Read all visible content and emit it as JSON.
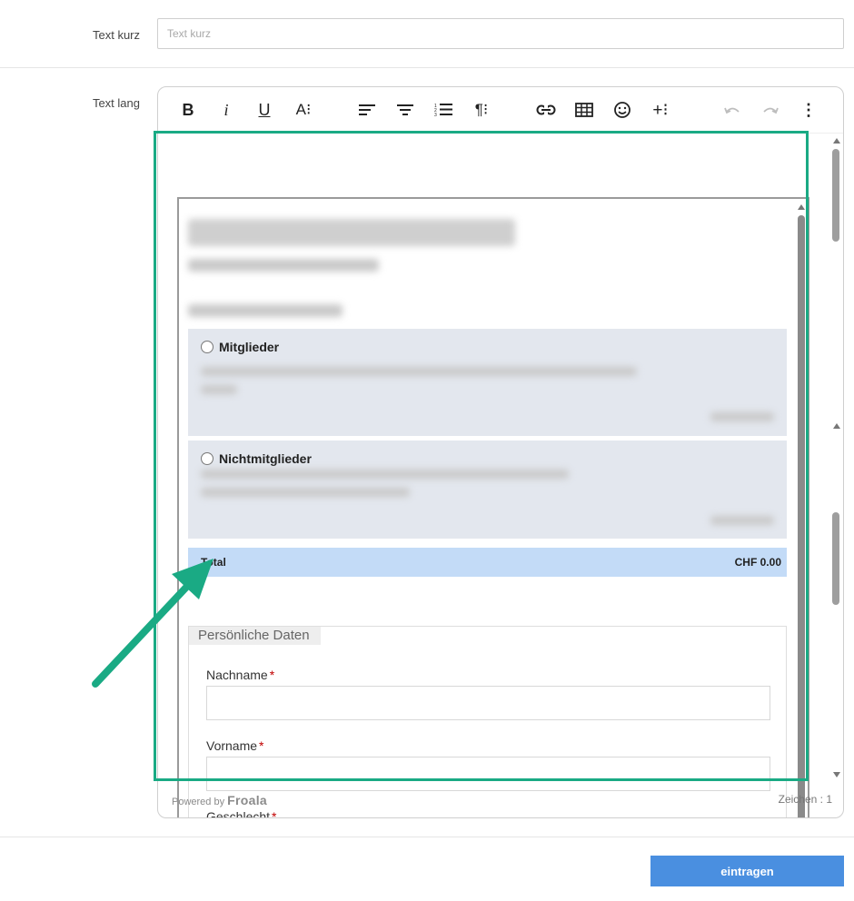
{
  "form": {
    "text_kurz": {
      "label": "Text kurz",
      "placeholder": "Text kurz",
      "value": ""
    },
    "text_lang": {
      "label": "Text lang"
    }
  },
  "toolbar": {
    "bold": "B",
    "italic": "i",
    "underline": "U",
    "font_size": "A⁝",
    "paragraph_format": "¶⁝",
    "insert_more": "+⁝",
    "more": "⋮",
    "icons": [
      "bold-icon",
      "italic-icon",
      "underline-icon",
      "font-size-icon",
      "align-left-icon",
      "align-center-icon",
      "ordered-list-icon",
      "paragraph-format-icon",
      "link-icon",
      "table-icon",
      "emoticon-icon",
      "insert-more-icon",
      "undo-icon",
      "redo-icon",
      "more-vertical-icon"
    ]
  },
  "content": {
    "options": [
      {
        "title": "Mitglieder"
      },
      {
        "title": "Nichtmitglieder"
      }
    ],
    "total": {
      "label": "Total",
      "value": "CHF 0.00"
    },
    "fieldset": {
      "legend": "Persönliche Daten",
      "fields": [
        {
          "label": "Nachname",
          "required": "*"
        },
        {
          "label": "Vorname",
          "required": "*"
        },
        {
          "label": "Geschlecht",
          "required": "*"
        }
      ]
    }
  },
  "footer": {
    "powered_by": "Powered by",
    "brand": "Froala",
    "char_count": "Zeichen : 1"
  },
  "actions": {
    "submit": "eintragen"
  },
  "colors": {
    "highlight": "#1aaa84",
    "submit": "#4a8fe0",
    "total_bar": "#c3dbf7",
    "option_card": "#e3e7ee",
    "required": "#c00000"
  }
}
